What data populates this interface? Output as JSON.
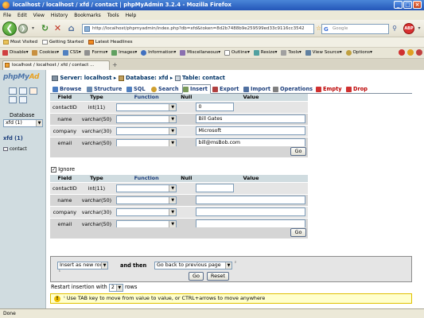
{
  "window": {
    "title": "localhost / localhost / xfd / contact | phpMyAdmin 3.2.4 - Mozilla Firefox"
  },
  "menu": [
    "File",
    "Edit",
    "View",
    "History",
    "Bookmarks",
    "Tools",
    "Help"
  ],
  "nav": {
    "url": "http://localhost/phpmyadmin/index.php?db=xfd&token=8d2b7488b9e259599ed33c9116cc3542",
    "search_placeholder": "Google"
  },
  "bookmarks": [
    "Most Visited",
    "Getting Started",
    "Latest Headlines"
  ],
  "devbar": [
    "Disable",
    "Cookies",
    "CSS",
    "Forms",
    "Images",
    "Information",
    "Miscellaneous",
    "Outline",
    "Resize",
    "Tools",
    "View Source",
    "Options"
  ],
  "browser_tab": {
    "title": "localhost / localhost / xfd / contact ..."
  },
  "left_panel": {
    "logo_main": "phpMy",
    "logo_accent": "Ad",
    "database_label": "Database",
    "db_select": "xfd (1)",
    "db_link": "xfd (1)",
    "table_item": "contact"
  },
  "breadcrumb": {
    "server": "Server: localhost",
    "database": "Database: xfd",
    "table": "Table: contact"
  },
  "tabs": [
    {
      "label": "Browse",
      "icon": "browse-icon",
      "color": "#4a7cc0"
    },
    {
      "label": "Structure",
      "icon": "structure-icon",
      "color": "#6a8ab0"
    },
    {
      "label": "SQL",
      "icon": "sql-icon",
      "color": "#5080c0"
    },
    {
      "label": "Search",
      "icon": "search-icon",
      "color": "#d0a030"
    },
    {
      "label": "Insert",
      "icon": "insert-icon",
      "color": "#7a9a5a"
    },
    {
      "label": "Export",
      "icon": "export-icon",
      "color": "#b04040"
    },
    {
      "label": "Import",
      "icon": "import-icon",
      "color": "#5070a0"
    },
    {
      "label": "Operations",
      "icon": "operations-icon",
      "color": "#808080"
    },
    {
      "label": "Empty",
      "icon": "empty-icon",
      "color": "#d03030"
    },
    {
      "label": "Drop",
      "icon": "drop-icon",
      "color": "#d03030"
    }
  ],
  "table_headers": {
    "field": "Field",
    "type": "Type",
    "function": "Function",
    "null": "Null",
    "value": "Value"
  },
  "form1_rows": [
    {
      "field": "contactID",
      "type": "int(11)",
      "value": "0"
    },
    {
      "field": "name",
      "type": "varchar(50)",
      "value": "Bill Gates"
    },
    {
      "field": "company",
      "type": "varchar(30)",
      "value": "Microsoft"
    },
    {
      "field": "email",
      "type": "varchar(50)",
      "value": "bill@msBob.com"
    }
  ],
  "form2_rows": [
    {
      "field": "contactID",
      "type": "int(11)",
      "value": ""
    },
    {
      "field": "name",
      "type": "varchar(50)",
      "value": ""
    },
    {
      "field": "company",
      "type": "varchar(30)",
      "value": ""
    },
    {
      "field": "email",
      "type": "varchar(50)",
      "value": ""
    }
  ],
  "go_label": "Go",
  "ignore_label": "Ignore",
  "bottom": {
    "insert_mode": "Insert as new row",
    "and_then": "and then",
    "after_action": "Go back to previous page",
    "go_label": "Go",
    "reset_label": "Reset",
    "restart_label": "Restart insertion with",
    "restart_count": "2",
    "rows_label": "rows"
  },
  "tip": "Use TAB key to move from value to value, or CTRL+arrows to move anywhere",
  "status": "Done"
}
